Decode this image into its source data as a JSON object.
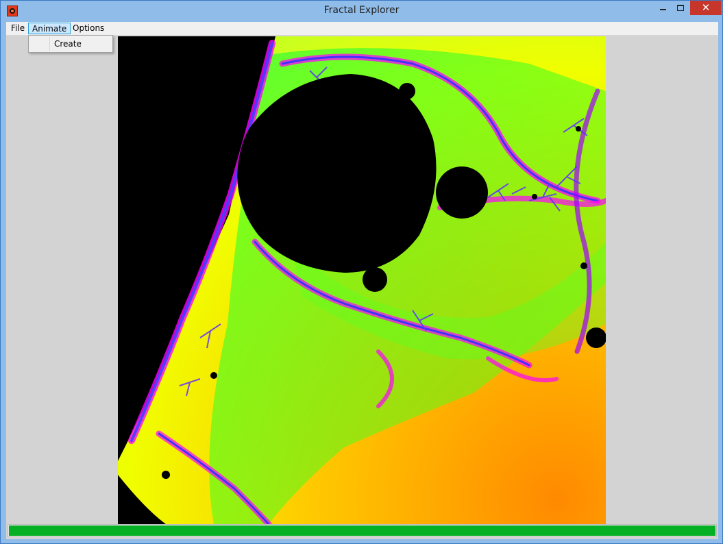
{
  "window": {
    "title": "Fractal Explorer",
    "close_glyph": "✕"
  },
  "menu": {
    "items": [
      {
        "label": "File"
      },
      {
        "label": "Animate"
      },
      {
        "label": "Options"
      }
    ],
    "open_menu": {
      "items": [
        {
          "label": "Create"
        }
      ]
    }
  },
  "icons": {
    "app": "fractal-app-icon",
    "minimize": "minimize-icon",
    "maximize": "maximize-icon",
    "close": "close-icon"
  },
  "colors": {
    "titlebar": "#8fbce8",
    "close_button": "#c7362a",
    "progress_fill": "#06b025",
    "fractal_interior": "#000000"
  },
  "progress": {
    "fraction": 1.0
  }
}
